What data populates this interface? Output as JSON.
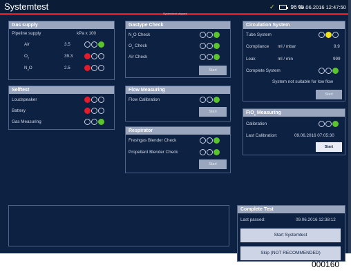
{
  "title": "Systemtest",
  "status_message": "Systemtest stopped",
  "battery_percent": "96 %",
  "datetime": "09.06.2016 12:47:50",
  "colors": {
    "alarm": "#e21c2b",
    "ok": "#5bc42c",
    "warn": "#f2e21c",
    "header": "#9aa6bd",
    "background": "#0d2142"
  },
  "gas_supply": {
    "title": "Gas supply",
    "pipeline_label": "Pipeline supply",
    "unit": "kPa x 100",
    "rows": [
      {
        "name": "Air",
        "sub": "",
        "value": "3.5",
        "leds": [
          "off",
          "off",
          "green"
        ]
      },
      {
        "name": "O",
        "sub": "2",
        "value": "39.3",
        "leds": [
          "red",
          "off",
          "off"
        ]
      },
      {
        "name": "N",
        "sub": "2",
        "suffix": "O",
        "value": "2.5",
        "leds": [
          "red",
          "off",
          "off"
        ]
      }
    ]
  },
  "selftest": {
    "title": "Selftest",
    "rows": [
      {
        "name": "Loudspeaker",
        "leds": [
          "red",
          "off",
          "off"
        ]
      },
      {
        "name": "Battery",
        "leds": [
          "red",
          "off",
          "off"
        ]
      },
      {
        "name": "Gas Measuring",
        "leds": [
          "off",
          "off",
          "green"
        ]
      }
    ]
  },
  "gastype_check": {
    "title": "Gastype Check",
    "rows": [
      {
        "name": "N",
        "sub": "2",
        "suffix": "O Check",
        "leds": [
          "off",
          "off",
          "green"
        ]
      },
      {
        "name": "O",
        "sub": "2",
        "suffix": " Check",
        "leds": [
          "off",
          "off",
          "green"
        ]
      },
      {
        "name": "Air Check",
        "sub": "",
        "suffix": "",
        "leds": [
          "off",
          "off",
          "green"
        ]
      }
    ],
    "start_label": "Start"
  },
  "flow_measuring": {
    "title": "Flow Measuring",
    "rows": [
      {
        "name": "Flow Calibration",
        "leds": [
          "off",
          "off",
          "green"
        ]
      }
    ],
    "start_label": "Start"
  },
  "respirator": {
    "title": "Respirator",
    "rows": [
      {
        "name": "Freshgas Blender Check",
        "leds": [
          "off",
          "off",
          "green"
        ]
      },
      {
        "name": "Propellant Blender Check",
        "leds": [
          "off",
          "off",
          "green"
        ]
      }
    ],
    "start_label": "Start"
  },
  "circulation": {
    "title": "Circulation System",
    "tube_label": "Tube System",
    "tube_leds": [
      "off",
      "yellow",
      "off"
    ],
    "compliance_label": "Compliance",
    "compliance_unit": "ml / mbar",
    "compliance_value": "9.9",
    "leak_label": "Leak",
    "leak_unit": "ml / min",
    "leak_value": "999",
    "complete_label": "Complete System",
    "complete_leds": [
      "off",
      "off",
      "green"
    ],
    "note": "System not suitable for low flow",
    "start_label": "Start"
  },
  "fio2": {
    "title": "FiO",
    "title_sub": "2",
    "title_suffix": " Measuring",
    "calibration_label": "Calibration",
    "calibration_leds": [
      "off",
      "off",
      "green"
    ],
    "last_cal_label": "Last Calibration:",
    "last_cal_value": "09.06.2016  07:05:30",
    "start_label": "Start"
  },
  "complete_test": {
    "title": "Complete Test",
    "last_passed_label": "Last passed:",
    "last_passed_value": "09.06.2016  12:38:12",
    "start_label": "Start Systemtest",
    "skip_label": "Skip (NOT RECOMMENDED)"
  },
  "doc_number": "000160"
}
